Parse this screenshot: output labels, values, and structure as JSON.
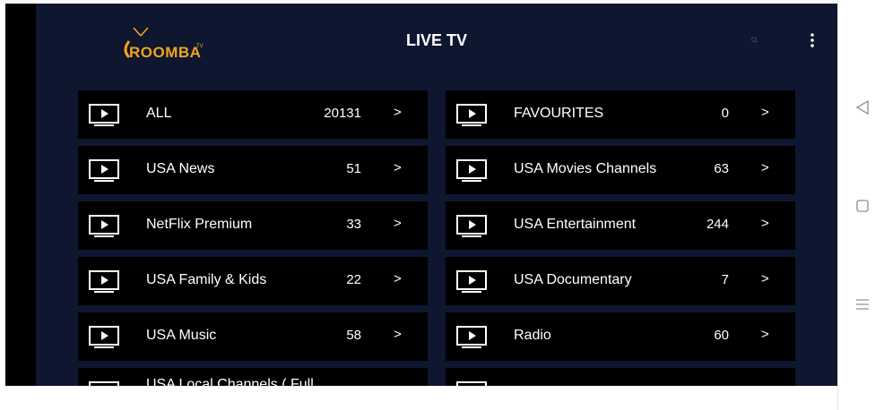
{
  "app": {
    "logo_text": "ROOMBA",
    "logo_suffix": "TV",
    "title": "LIVE TV"
  },
  "categories": [
    {
      "label": "ALL",
      "count": "20131"
    },
    {
      "label": "FAVOURITES",
      "count": "0"
    },
    {
      "label": "USA News",
      "count": "51"
    },
    {
      "label": "USA Movies Channels",
      "count": "63"
    },
    {
      "label": "NetFlix Premium",
      "count": "33"
    },
    {
      "label": "USA Entertainment",
      "count": "244"
    },
    {
      "label": "USA Family & Kids",
      "count": "22"
    },
    {
      "label": "USA Documentary",
      "count": "7"
    },
    {
      "label": "USA Music",
      "count": "58"
    },
    {
      "label": "Radio",
      "count": "60"
    },
    {
      "label": "USA Local Channels ( Full",
      "count": ""
    },
    {
      "label": "",
      "count": ""
    }
  ],
  "chevron": ">",
  "colors": {
    "background": "#0e1630",
    "card": "#000000",
    "accent": "#f2a31b",
    "text": "#ffffff"
  },
  "icons": {
    "category": "tv-play-icon",
    "search": "search-icon",
    "menu": "more-vert-icon",
    "nav_back": "triangle-back-icon",
    "nav_home": "square-home-icon",
    "nav_recents": "menu-lines-icon"
  }
}
